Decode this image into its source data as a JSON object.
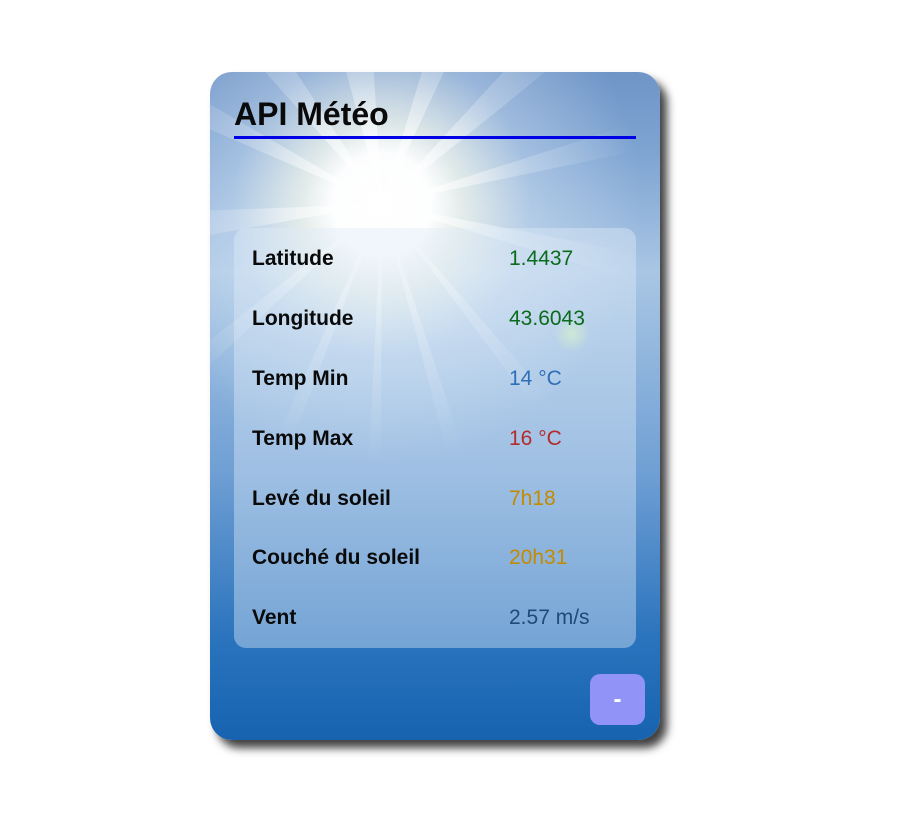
{
  "card": {
    "title": "API Météo",
    "rows": [
      {
        "label": "Latitude",
        "value": "1.4437",
        "color": "#0b6b1d"
      },
      {
        "label": "Longitude",
        "value": "43.6043",
        "color": "#0b6b1d"
      },
      {
        "label": "Temp Min",
        "value": "14 °C",
        "color": "#2e6fb8"
      },
      {
        "label": "Temp Max",
        "value": "16 °C",
        "color": "#b52a2a"
      },
      {
        "label": "Levé du soleil",
        "value": "7h18",
        "color": "#c48a00"
      },
      {
        "label": "Couché du soleil",
        "value": "20h31",
        "color": "#c48a00"
      },
      {
        "label": "Vent",
        "value": "2.57 m/s",
        "color": "#1f4a78"
      }
    ],
    "toggle_label": "-",
    "accent": "#0000e6",
    "button_color": "#9193f6"
  }
}
